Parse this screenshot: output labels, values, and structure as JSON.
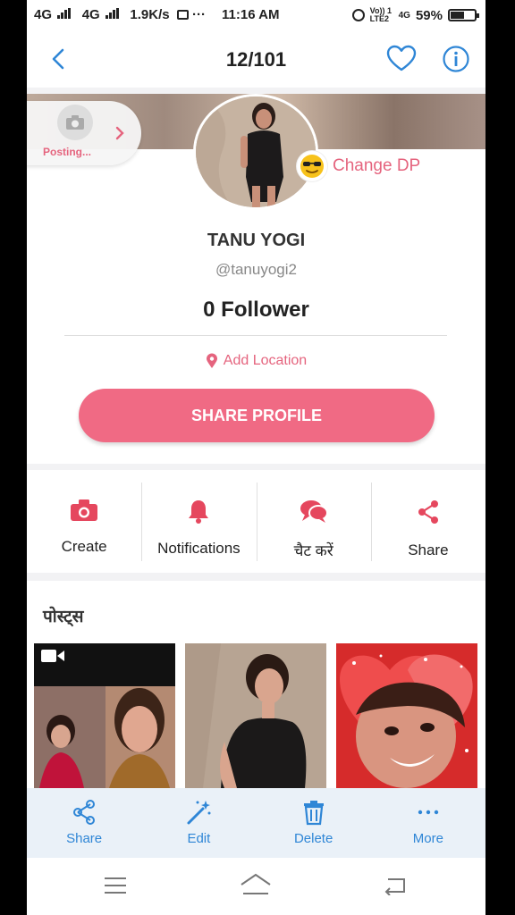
{
  "status_bar": {
    "network_left": "4G",
    "network_right": "4G",
    "speed": "1.9K/s",
    "dots": "···",
    "time": "11:16 AM",
    "volte": "Vo)) 1 LTE2",
    "net_small": "4G",
    "battery": "59%",
    "battery_level": 0.59
  },
  "header": {
    "counter": "12/101"
  },
  "profile": {
    "posting_label": "Posting...",
    "change_dp": "Change DP",
    "name": "TANU YOGI",
    "handle": "@tanuyogi2",
    "followers": "0 Follower",
    "location": "Add Location",
    "share_profile": "SHARE PROFILE"
  },
  "actions": [
    {
      "label": "Create",
      "icon": "camera-icon"
    },
    {
      "label": "Notifications",
      "icon": "bell-icon"
    },
    {
      "label": "चैट करें",
      "icon": "chat-icon"
    },
    {
      "label": "Share",
      "icon": "share-icon"
    }
  ],
  "posts": {
    "title": "पोस्ट्स"
  },
  "bottom_bar": [
    {
      "label": "Share",
      "icon": "share-icon"
    },
    {
      "label": "Edit",
      "icon": "magic-wand-icon"
    },
    {
      "label": "Delete",
      "icon": "trash-icon"
    },
    {
      "label": "More",
      "icon": "more-dots-icon"
    }
  ],
  "colors": {
    "accent_pink": "#f06a84",
    "pink_text": "#e5647e",
    "blue": "#2f86d6",
    "bottom_bar_bg": "#eaf1f8"
  }
}
